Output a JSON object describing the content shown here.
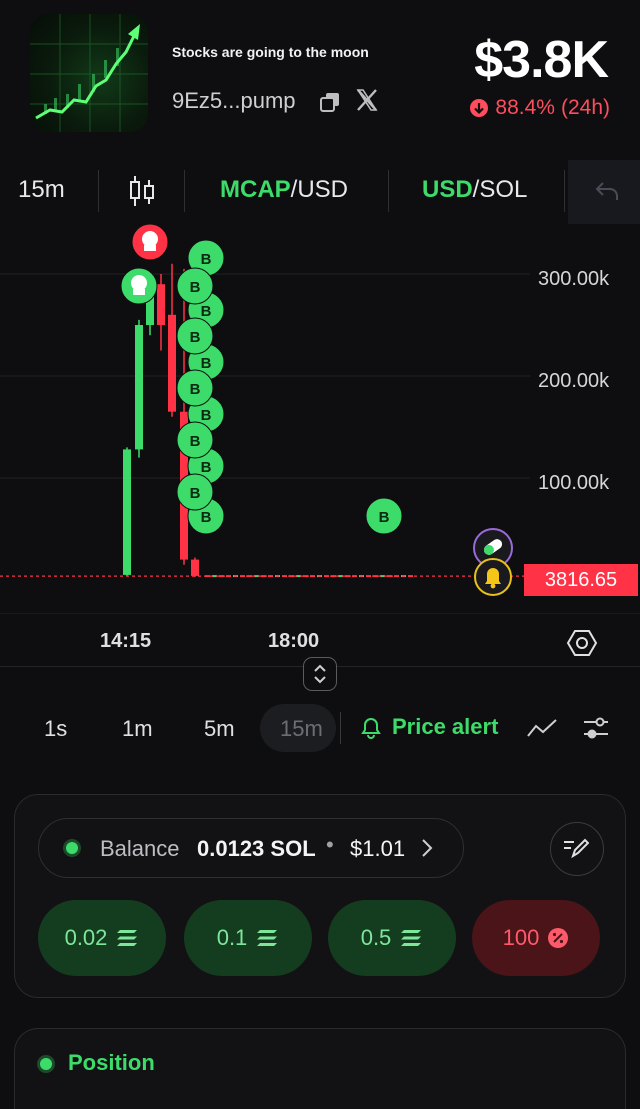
{
  "header": {
    "token_name": "Stocks are going to the moon",
    "token_address": "9Ez5...pump",
    "market_cap": "$3.8K",
    "change_pct": "88.4%",
    "change_period": "(24h)",
    "icons": {
      "copy": "copy-icon",
      "x": "x-icon",
      "change": "arrow-down-circle-icon"
    }
  },
  "toolbar": {
    "interval": "15m",
    "mcap_accent": "MCAP",
    "mcap_rest": "/USD",
    "usd_accent": "USD",
    "usd_rest": "/SOL",
    "icons": {
      "candles": "candlestick-icon",
      "undo": "undo-icon"
    }
  },
  "chart": {
    "y_ticks": [
      "300.00k",
      "200.00k",
      "100.00k"
    ],
    "x_ticks": [
      "14:15",
      "18:00"
    ],
    "current_price": "3816.65",
    "buy_marker_label": "B",
    "colors": {
      "up": "#3ddc6a",
      "down": "#ff3246",
      "grid": "#222226"
    }
  },
  "chart_data": {
    "type": "candlestick",
    "y_unit": "market cap (USD)",
    "ylim": [
      0,
      320000
    ],
    "y_ticks": [
      100000,
      200000,
      300000
    ],
    "x_ticks": [
      "14:15",
      "18:00"
    ],
    "candles": [
      {
        "open": 5000,
        "high": 130000,
        "low": 4000,
        "close": 128000
      },
      {
        "open": 128000,
        "high": 255000,
        "low": 120000,
        "close": 250000
      },
      {
        "open": 250000,
        "high": 300000,
        "low": 240000,
        "close": 285000
      },
      {
        "open": 290000,
        "high": 300000,
        "low": 225000,
        "close": 250000
      },
      {
        "open": 260000,
        "high": 310000,
        "low": 160000,
        "close": 165000
      },
      {
        "open": 165000,
        "high": 305000,
        "low": 15000,
        "close": 20000
      },
      {
        "open": 20000,
        "high": 22000,
        "low": 3000,
        "close": 4000
      }
    ],
    "current_value": 3816.65
  },
  "intervals": [
    "1s",
    "1m",
    "5m",
    "15m"
  ],
  "price_alert_label": "Price alert",
  "balance": {
    "label": "Balance",
    "sol": "0.0123 SOL",
    "separator": "•",
    "usd": "$1.01"
  },
  "quick_buy": [
    "0.02",
    "0.1",
    "0.5"
  ],
  "quick_sell": "100",
  "position_label": "Position"
}
